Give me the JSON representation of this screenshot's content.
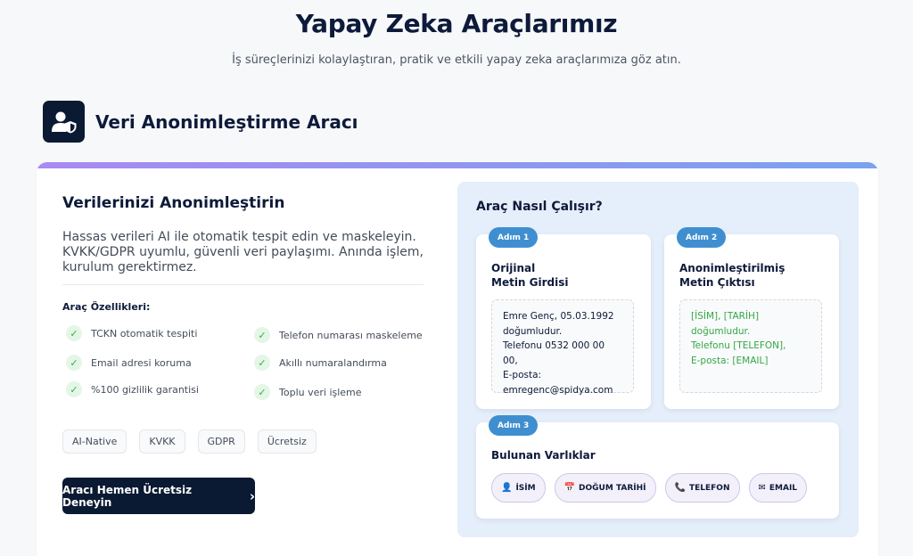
{
  "hero": {
    "title": "Yapay Zeka Araçlarımız",
    "subtitle": "İş süreçlerinizi kolaylaştıran, pratik ve etkili yapay zeka araçlarımıza göz atın."
  },
  "tool": {
    "title": "Veri Anonimleştirme Aracı",
    "icon": "user-shield-icon"
  },
  "left": {
    "heading": "Verilerinizi Anonimleştirin",
    "description": "Hassas verileri AI ile otomatik tespit edin ve maskeleyin. KVKK/GDPR uyumlu, güvenli veri paylaşımı. Anında işlem, kurulum gerektirmez.",
    "features_title": "Araç Özellikleri:",
    "features": [
      "TCKN otomatik tespiti",
      "Telefon numarası maskeleme",
      "Email adresi koruma",
      "Akıllı numaralandırma",
      "%100 gizlilik garantisi",
      "Toplu veri işleme"
    ],
    "tags": [
      "AI-Native",
      "KVKK",
      "GDPR",
      "Ücretsiz"
    ],
    "cta": "Aracı Hemen Ücretsiz Deneyin",
    "cta_arrow": "›"
  },
  "right": {
    "heading": "Araç Nasıl Çalışır?",
    "step1": {
      "badge": "Adım 1",
      "title_line1": "Orijinal",
      "title_line2": "Metin Girdisi",
      "lines": [
        "Emre Genç, 05.03.1992",
        "doğumludur.",
        "Telefonu 0532 000 00 00,",
        "E-posta:",
        "emregenc@spidya.com"
      ]
    },
    "step2": {
      "badge": "Adım 2",
      "title_line1": "Anonimleştirilmiş",
      "title_line2": "Metin Çıktısı",
      "lines": [
        "[İSİM], [TARİH]",
        "doğumludur.",
        "Telefonu [TELEFON],",
        "E-posta: [EMAIL]"
      ]
    },
    "step3": {
      "badge": "Adım 3",
      "title": "Bulunan Varlıklar",
      "entities": [
        {
          "icon": "👤",
          "label": "İSİM"
        },
        {
          "icon": "📅",
          "label": "DOĞUM TARİHİ"
        },
        {
          "icon": "📞",
          "label": "TELEFON"
        },
        {
          "icon": "✉",
          "label": "EMAIL"
        }
      ]
    }
  },
  "colors": {
    "navy": "#0b1a33",
    "accent_blue": "#3f8fd0",
    "success_green": "#34a748",
    "panel_bg": "#e5eefb"
  }
}
